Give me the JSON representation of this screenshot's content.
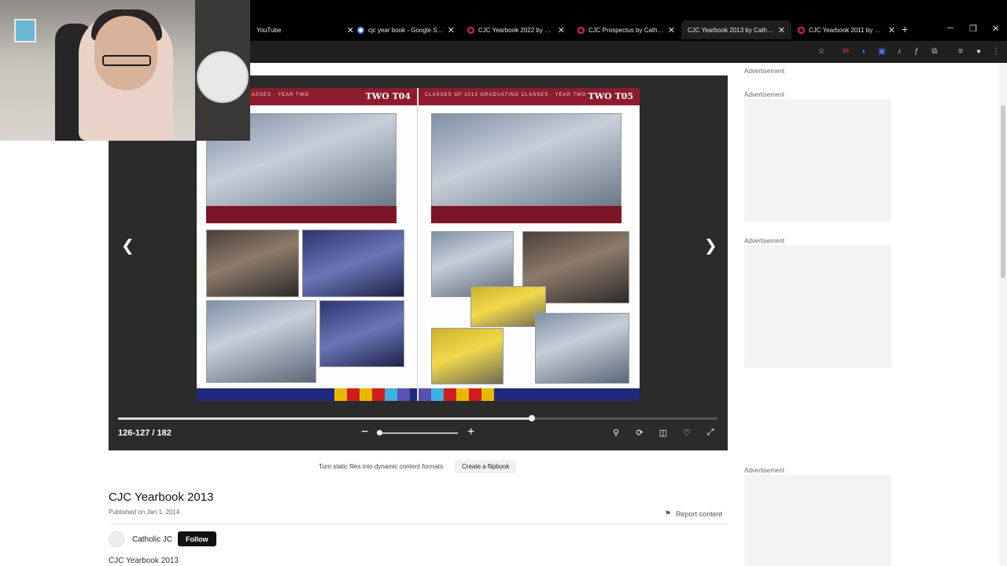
{
  "browser": {
    "tabs": [
      {
        "title": "YouTube",
        "favicon_color": "#ff0000",
        "active": false
      },
      {
        "title": "cjc year book - Google Search",
        "favicon_color": "#4285f4",
        "active": false
      },
      {
        "title": "CJC Yearbook 2022 by Catholic JC",
        "favicon_color": "#e0284a",
        "active": false
      },
      {
        "title": "CJC Prospectus by Catholic JC",
        "favicon_color": "#e0284a",
        "active": false
      },
      {
        "title": "CJC Yearbook 2013 by Catholic JC",
        "favicon_color": "#e0284a",
        "active": true
      },
      {
        "title": "CJC Yearbook 2011 by Catholic JC",
        "favicon_color": "#e0284a",
        "active": false
      }
    ],
    "new_tab": "+",
    "close_glyph": "✕"
  },
  "viewer": {
    "left_page_class": "TWO T04",
    "right_page_class": "TWO T05",
    "left_page_header": "GRADUATING CLASSES · YEAR TWO",
    "right_page_header": "CLASSES OF 2013 GRADUATING CLASSES · YEAR TWO",
    "page_indicator": "126-127 / 182",
    "progress_fraction": 0.69,
    "zoom_fraction": 0.0,
    "prev_arrow": "❮",
    "next_arrow": "❯",
    "zoom_out": "−",
    "zoom_in": "+"
  },
  "ads": {
    "label": "Advertisement"
  },
  "promo": {
    "text": "Turn static files into dynamic content formats.",
    "button": "Create a flipbook"
  },
  "document": {
    "title": "CJC Yearbook 2013",
    "published": "Published on Jan 1, 2014",
    "report": "Report content",
    "publisher": "Catholic JC",
    "follow": "Follow",
    "description": "CJC Yearbook 2013"
  }
}
